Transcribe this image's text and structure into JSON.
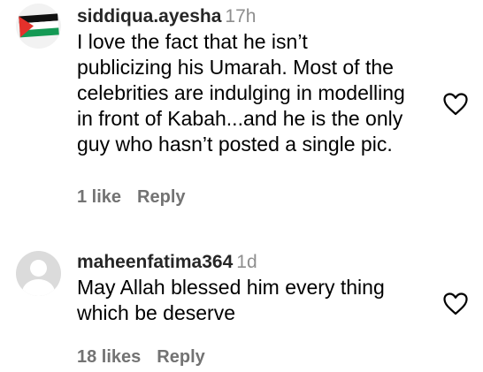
{
  "comments": [
    {
      "username": "siddiqua.ayesha",
      "time": "17h",
      "lines": [
        "I love the fact that he isn’t",
        "publicizing his Umarah. Most of the",
        "celebrities are indulging in modelling",
        "in front of Kabah...and he is the only",
        "guy who hasn’t posted a single pic."
      ],
      "likes": "1 like",
      "reply": "Reply",
      "avatar_icon": "palestine-flag-avatar",
      "like_icon": "heart-outline-icon"
    },
    {
      "username": "maheenfatima364",
      "time": "1d",
      "lines": [
        "May Allah blessed him every thing",
        "which be deserve"
      ],
      "likes": "18 likes",
      "reply": "Reply",
      "avatar_icon": "default-user-avatar",
      "like_icon": "heart-outline-icon"
    }
  ],
  "colors": {
    "username": "#262626",
    "meta": "#8e8e8e",
    "actions": "#737373",
    "flag_black": "#000000",
    "flag_white": "#ffffff",
    "flag_green": "#149954",
    "flag_red": "#e4312b"
  }
}
